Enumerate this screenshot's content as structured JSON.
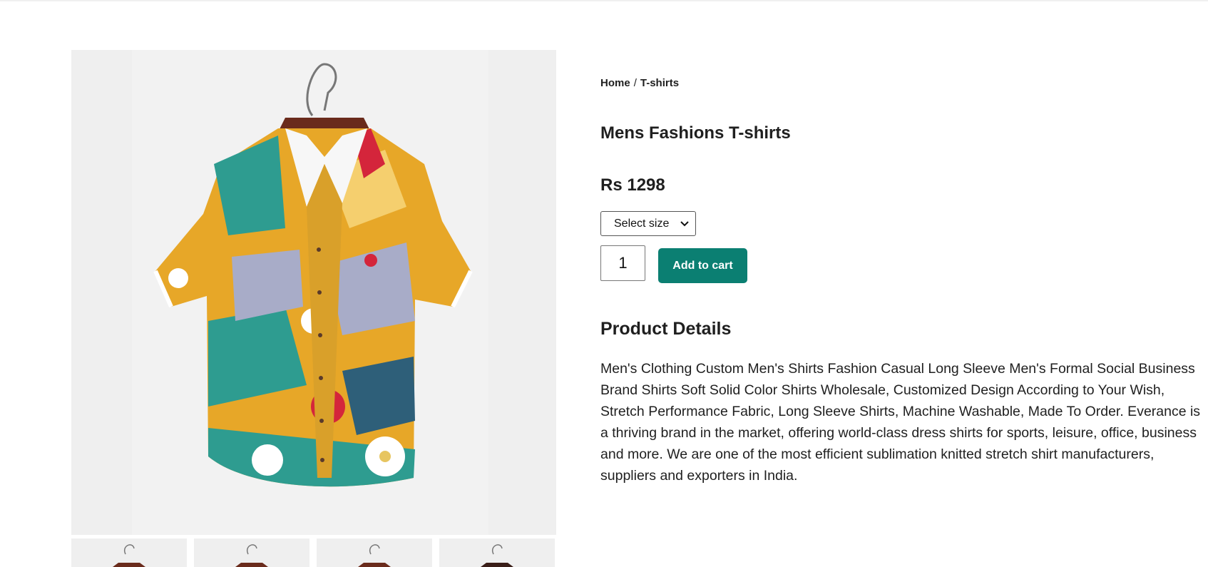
{
  "breadcrumb": {
    "home": "Home",
    "separator": "/",
    "current": "T-shirts"
  },
  "product": {
    "title": "Mens Fashions T-shirts",
    "price": "Rs 1298",
    "size_select": {
      "selected": "Select size"
    },
    "quantity": "1",
    "add_to_cart_label": "Add to cart",
    "image": {
      "icon": "shirt-image",
      "thumbnail_count": 4
    }
  },
  "details": {
    "heading": "Product Details",
    "text": "Men's Clothing Custom Men's Shirts Fashion Casual Long Sleeve Men's Formal Social Business Brand Shirts Soft Solid Color Shirts Wholesale, Customized Design According to Your Wish, Stretch Performance Fabric, Long Sleeve Shirts, Machine Washable, Made To Order. Everance is a thriving brand in the market, offering world-class dress shirts for sports, leisure, office, business and more. We are one of the most efficient sublimation knitted stretch shirt manufacturers, suppliers and exporters in India."
  },
  "colors": {
    "accent": "#0b7f72",
    "image_bg": "#efefef",
    "text": "#1f1f1f"
  }
}
